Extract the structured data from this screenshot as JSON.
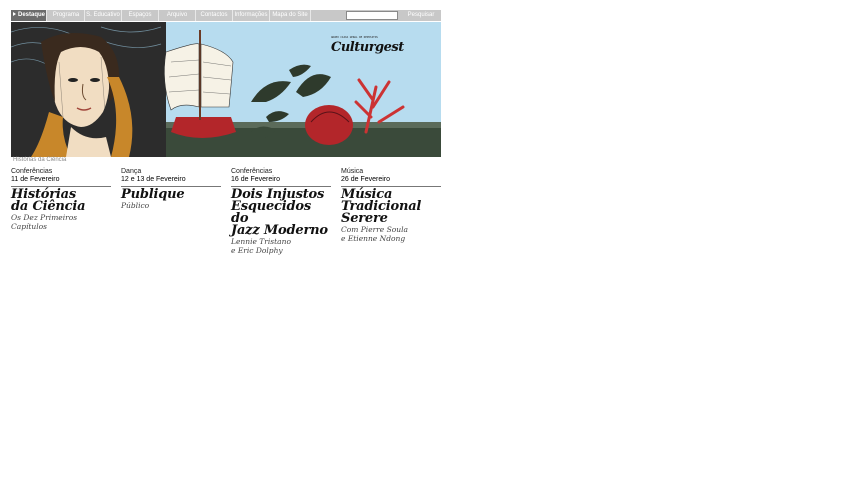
{
  "nav": {
    "items": [
      {
        "label": "Destaque",
        "active": true
      },
      {
        "label": "Programa"
      },
      {
        "label": "S. Educativo"
      },
      {
        "label": "Espaços"
      },
      {
        "label": "Arquivo"
      },
      {
        "label": "Contactos"
      },
      {
        "label": "Informações"
      },
      {
        "label": "Mapa do Site"
      }
    ],
    "search_value": "",
    "search_button": "Pesquisar"
  },
  "banner": {
    "logo": "Culturgest",
    "logo_tagline": "GRUPO CAIXA GERAL DE DEPOSITOS",
    "caption": "Histórias da Ciência"
  },
  "columns": [
    {
      "category": "Conferências",
      "date": "11 de Fevereiro",
      "title_lines": [
        "Histórias",
        "da Ciência"
      ],
      "sub_lines": [
        "Os Dez Primeiros",
        "Capítulos"
      ]
    },
    {
      "category": "Dança",
      "date": "12 e 13 de Fevereiro",
      "title_lines": [
        "Publique"
      ],
      "sub_lines": [
        "Público"
      ]
    },
    {
      "category": "Conferências",
      "date": "16 de Fevereiro",
      "title_lines": [
        "Dois Injustos",
        "Esquecidos do",
        "Jazz Moderno"
      ],
      "sub_lines": [
        "Lennie Tristano",
        "e Eric Dolphy"
      ]
    },
    {
      "category": "Música",
      "date": "26 de Fevereiro",
      "title_lines": [
        "Música",
        "Tradicional",
        "Serere"
      ],
      "sub_lines": [
        "Com Pierre Soula",
        "e Etienne Ndong"
      ]
    }
  ],
  "colors": {
    "nav_bg": "#c8c8c8",
    "nav_active": "#6b6b6b",
    "banner_sky": "#b7dcef"
  }
}
